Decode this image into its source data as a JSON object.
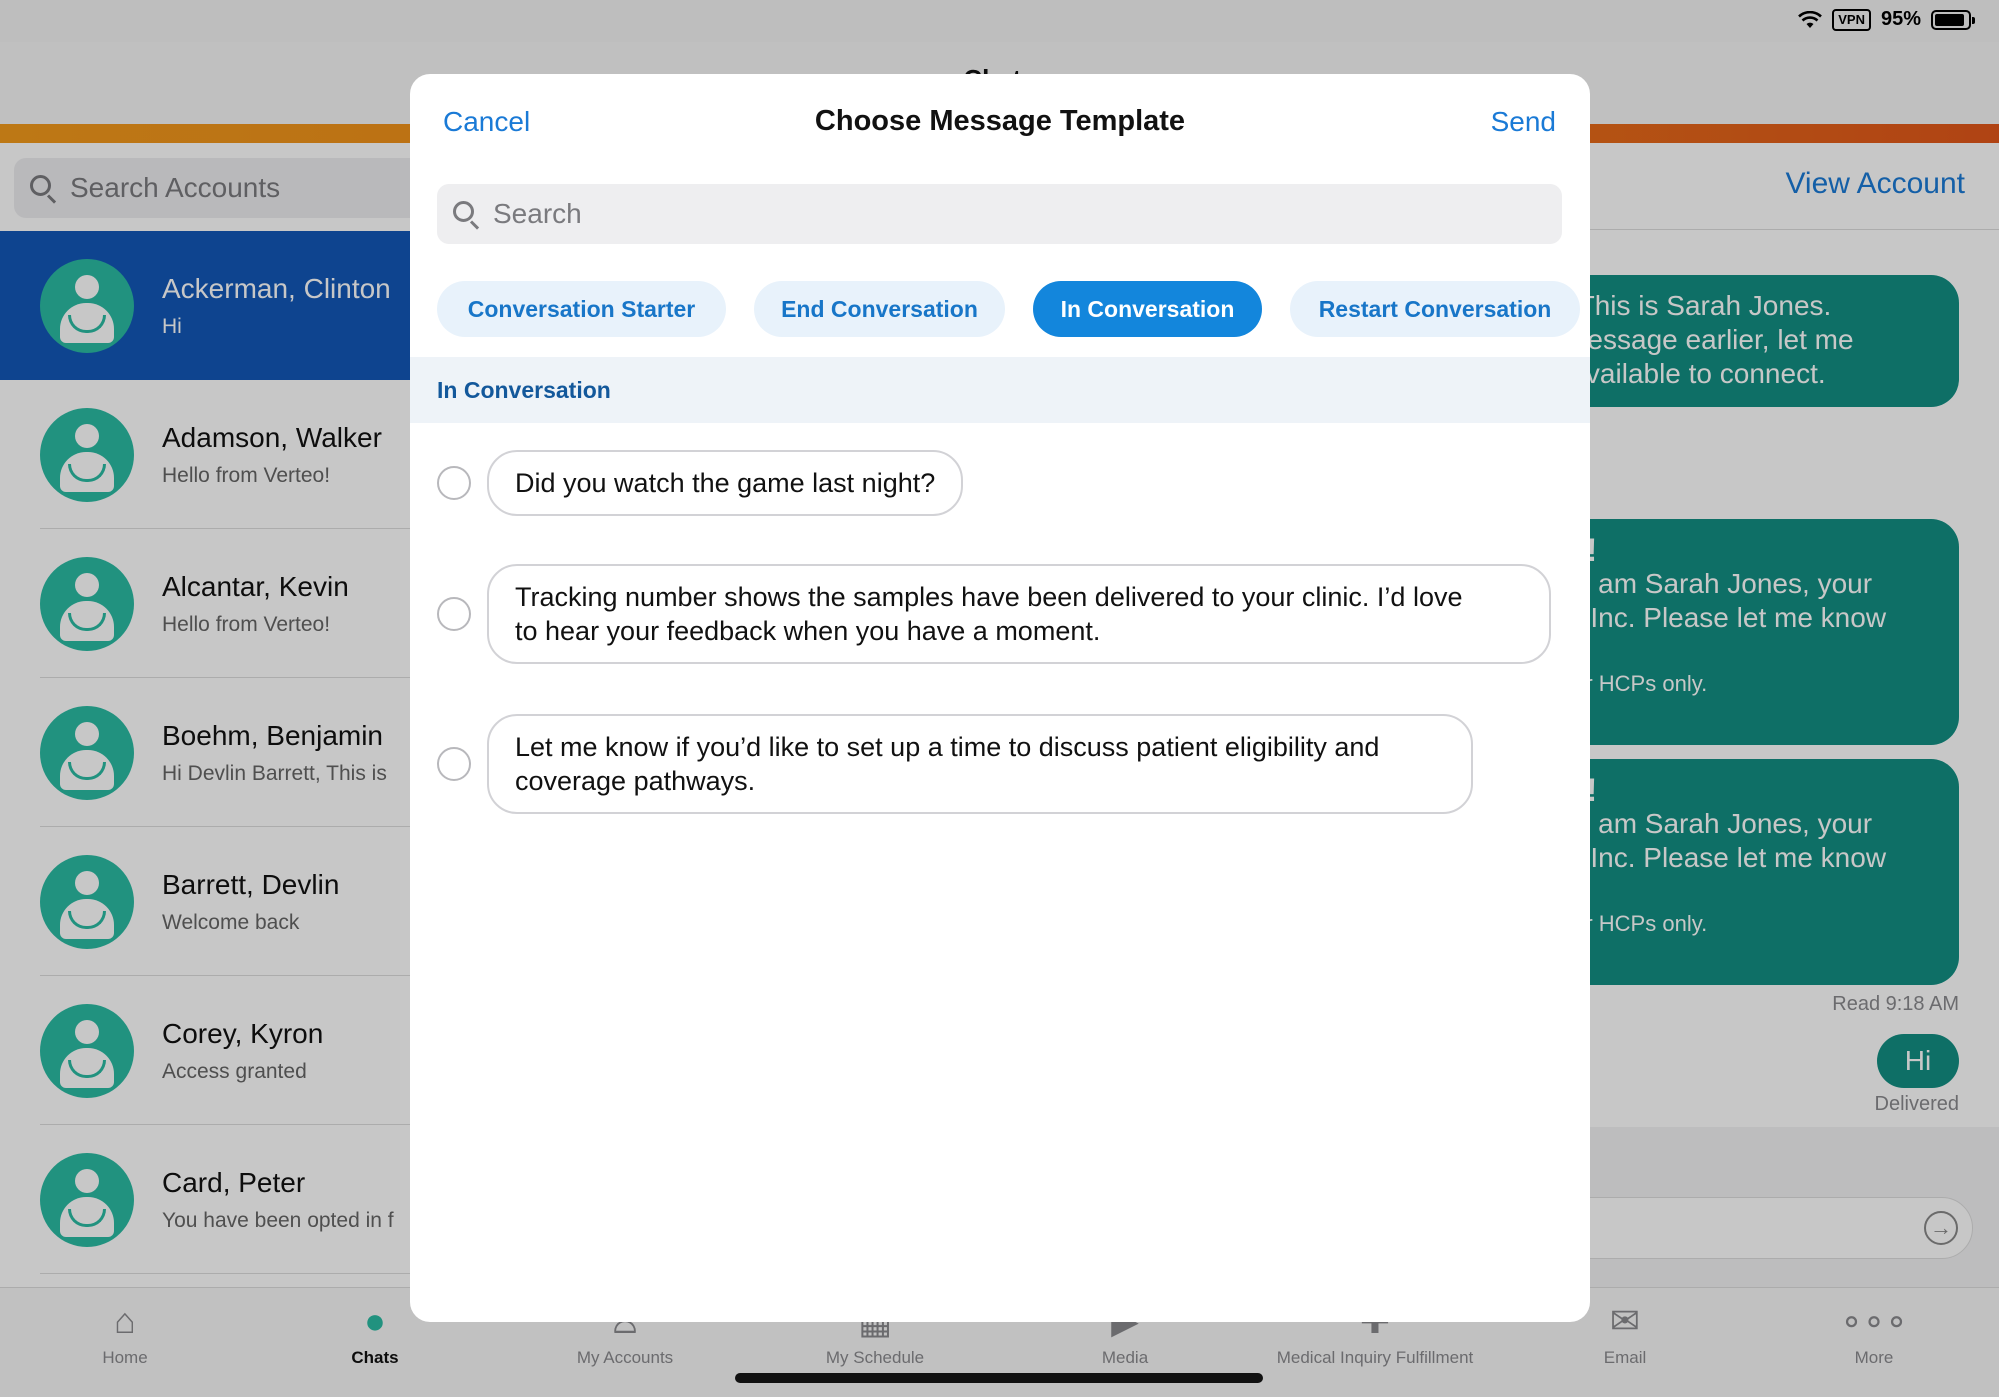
{
  "status_bar": {
    "battery": "95%",
    "vpn": "VPN"
  },
  "header": {
    "title": "Chats"
  },
  "left_pane": {
    "search_placeholder": "Search Accounts",
    "contacts": [
      {
        "name": "Ackerman, Clinton",
        "preview": "Hi",
        "selected": true
      },
      {
        "name": "Adamson, Walker",
        "preview": "Hello from Verteo!"
      },
      {
        "name": "Alcantar, Kevin",
        "preview": "Hello from Verteo!"
      },
      {
        "name": "Boehm, Benjamin",
        "preview": "Hi Devlin Barrett, This is"
      },
      {
        "name": "Barrett, Devlin",
        "preview": "Welcome back"
      },
      {
        "name": "Corey, Kyron",
        "preview": "Access granted"
      },
      {
        "name": "Card, Peter",
        "preview": "You have been opted in f"
      }
    ]
  },
  "right_pane": {
    "view_account": "View Account",
    "messages": [
      {
        "lines": [
          "n, This is Sarah Jones.",
          "r message earlier, let me",
          "e available to connect."
        ]
      },
      {
        "heading": "o!",
        "lines": [
          ", I am Sarah Jones, your",
          "o Inc. Please let me know"
        ],
        "footer": "for HCPs only."
      },
      {
        "heading": "o!",
        "lines": [
          ", I am Sarah Jones, your",
          "o Inc. Please let me know"
        ],
        "footer": "for HCPs only."
      }
    ],
    "read_status": "Read 9:18 AM",
    "last_message": "Hi",
    "delivered_status": "Delivered"
  },
  "modal": {
    "cancel_label": "Cancel",
    "title": "Choose Message Template",
    "send_label": "Send",
    "search_placeholder": "Search",
    "chips": [
      {
        "label": "Conversation Starter",
        "active": false
      },
      {
        "label": "End Conversation",
        "active": false
      },
      {
        "label": "In Conversation",
        "active": true
      },
      {
        "label": "Restart Conversation",
        "active": false
      }
    ],
    "section_title": "In Conversation",
    "templates": [
      {
        "lines": [
          "Did you watch the game last night?"
        ]
      },
      {
        "lines": [
          "Tracking number shows the samples have been delivered to your clinic. I’d love",
          "to hear your feedback when you have a moment."
        ]
      },
      {
        "lines": [
          "Let me know if you’d like to set up a time to discuss patient eligibility and",
          "coverage pathways."
        ]
      }
    ]
  },
  "tab_bar": {
    "tabs": [
      {
        "label": "Home",
        "icon": "home-icon"
      },
      {
        "label": "Chats",
        "icon": "chat-bubble-icon",
        "active": true
      },
      {
        "label": "My Accounts",
        "icon": "accounts-icon"
      },
      {
        "label": "My Schedule",
        "icon": "calendar-icon"
      },
      {
        "label": "Media",
        "icon": "media-icon"
      },
      {
        "label": "Medical Inquiry Fulfillment",
        "icon": "medical-inquiry-icon"
      },
      {
        "label": "Email",
        "icon": "email-icon"
      },
      {
        "label": "More",
        "icon": "more-icon"
      }
    ]
  },
  "colors": {
    "accent_blue": "#1a7ad6",
    "selected_row": "#1258b8",
    "teal": "#128f83",
    "avatar": "#2bbba3",
    "active_chip": "#1386dc",
    "brand_orange": "#f08a18"
  }
}
